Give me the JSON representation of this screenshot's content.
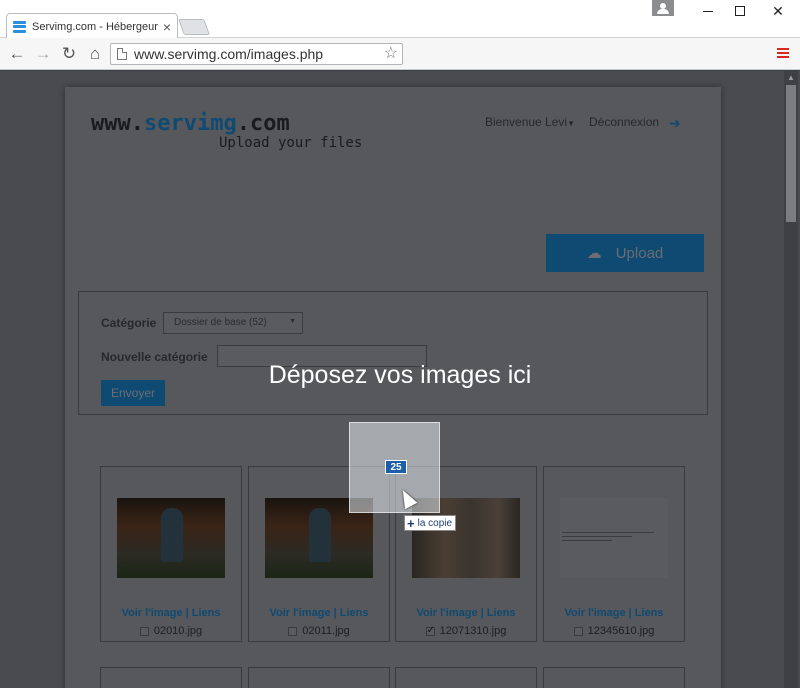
{
  "browser": {
    "tab_title": "Servimg.com - Hébergeur",
    "tab_close": "×",
    "url": "www.servimg.com/images.php",
    "win_close": "✕"
  },
  "header": {
    "logo_main_prefix": "www.",
    "logo_main_accent": "servimg",
    "logo_main_suffix": ".com",
    "logo_tagline": "Upload your files",
    "welcome": "Bienvenue Levi",
    "logout": "Déconnexion",
    "upload_label": "Upload"
  },
  "form": {
    "category_label": "Catégorie",
    "category_selected": "Dossier de base (52)",
    "new_category_label": "Nouvelle catégorie",
    "send_label": "Envoyer"
  },
  "gallery": {
    "links_label": "Voir l'image | Liens",
    "images": [
      {
        "file": "02010.jpg",
        "checked": false
      },
      {
        "file": "02011.jpg",
        "checked": false
      },
      {
        "file": "12071310.jpg",
        "checked": true
      },
      {
        "file": "12345610.jpg",
        "checked": false
      }
    ]
  },
  "overlay": {
    "drop_text": "Déposez vos images ici",
    "drag_count": "25",
    "copy_tooltip": "la copie"
  }
}
